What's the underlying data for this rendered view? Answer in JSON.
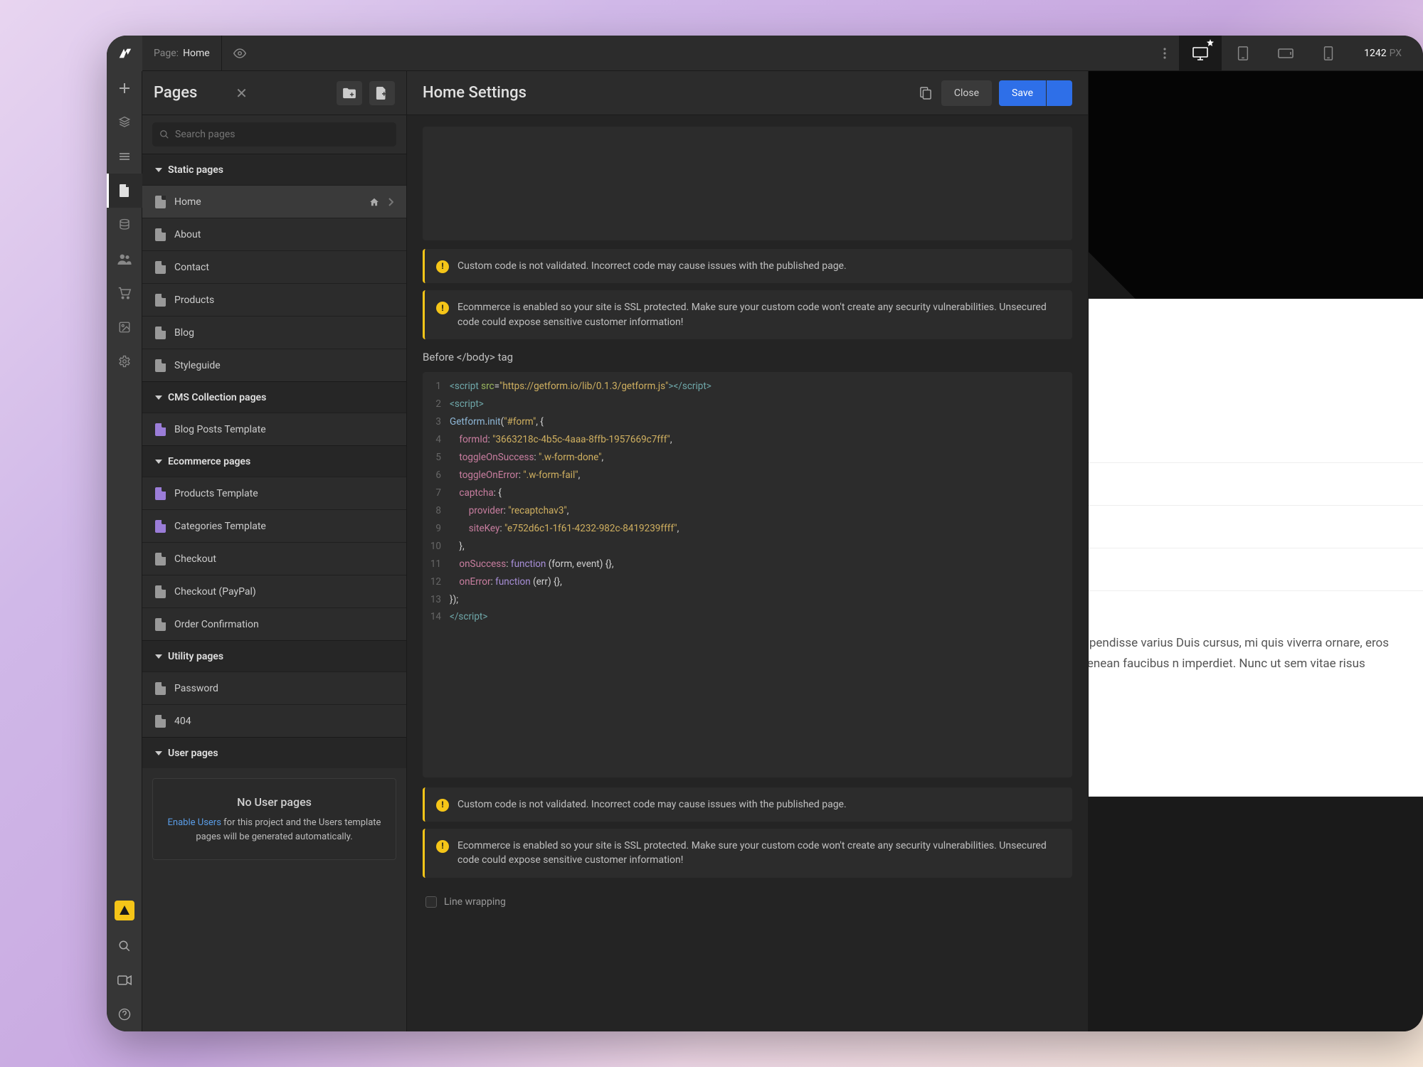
{
  "topbar": {
    "page_label": "Page:",
    "page_name": "Home",
    "viewport_width": "1242",
    "viewport_unit": "PX"
  },
  "pages_panel": {
    "title": "Pages",
    "search_placeholder": "Search pages",
    "sections": {
      "static": "Static pages",
      "cms": "CMS Collection pages",
      "ecom": "Ecommerce pages",
      "utility": "Utility pages",
      "user": "User pages"
    },
    "static_items": [
      "Home",
      "About",
      "Contact",
      "Products",
      "Blog",
      "Styleguide"
    ],
    "cms_items": [
      "Blog Posts Template"
    ],
    "ecom_items": [
      "Products Template",
      "Categories Template",
      "Checkout",
      "Checkout (PayPal)",
      "Order Confirmation"
    ],
    "utility_items": [
      "Password",
      "404"
    ],
    "user_empty": {
      "title": "No User pages",
      "link": "Enable Users",
      "rest": " for this project and the Users template pages will be generated automatically."
    }
  },
  "settings": {
    "title": "Home Settings",
    "close_label": "Close",
    "save_label": "Save",
    "warn_code": "Custom code is not validated. Incorrect code may cause issues with the published page.",
    "warn_ssl": "Ecommerce is enabled so your site is SSL protected. Make sure your custom code won't create any security vulnerabilities. Unsecured code could expose sensitive customer information!",
    "before_body_label": "Before </body> tag",
    "line_wrapping_label": "Line wrapping",
    "code": {
      "src_url": "https://getform.io/lib/0.1.3/getform.js",
      "selector": "#form",
      "formId": "3663218c-4b5c-4aaa-8ffb-1957669c7fff",
      "toggleOnSuccess": ".w-form-done",
      "toggleOnError": ".w-form-fail",
      "provider": "recaptchav3",
      "siteKey": "e752d6c1-1f61-4232-982c-8419239ffff"
    }
  },
  "canvas": {
    "lorem": "tetur adipiscing elit. Suspendisse varius Duis cursus, mi quis viverra ornare, eros diam libero vitae erat. Aenean faucibus n imperdiet. Nunc ut sem vitae risus"
  }
}
